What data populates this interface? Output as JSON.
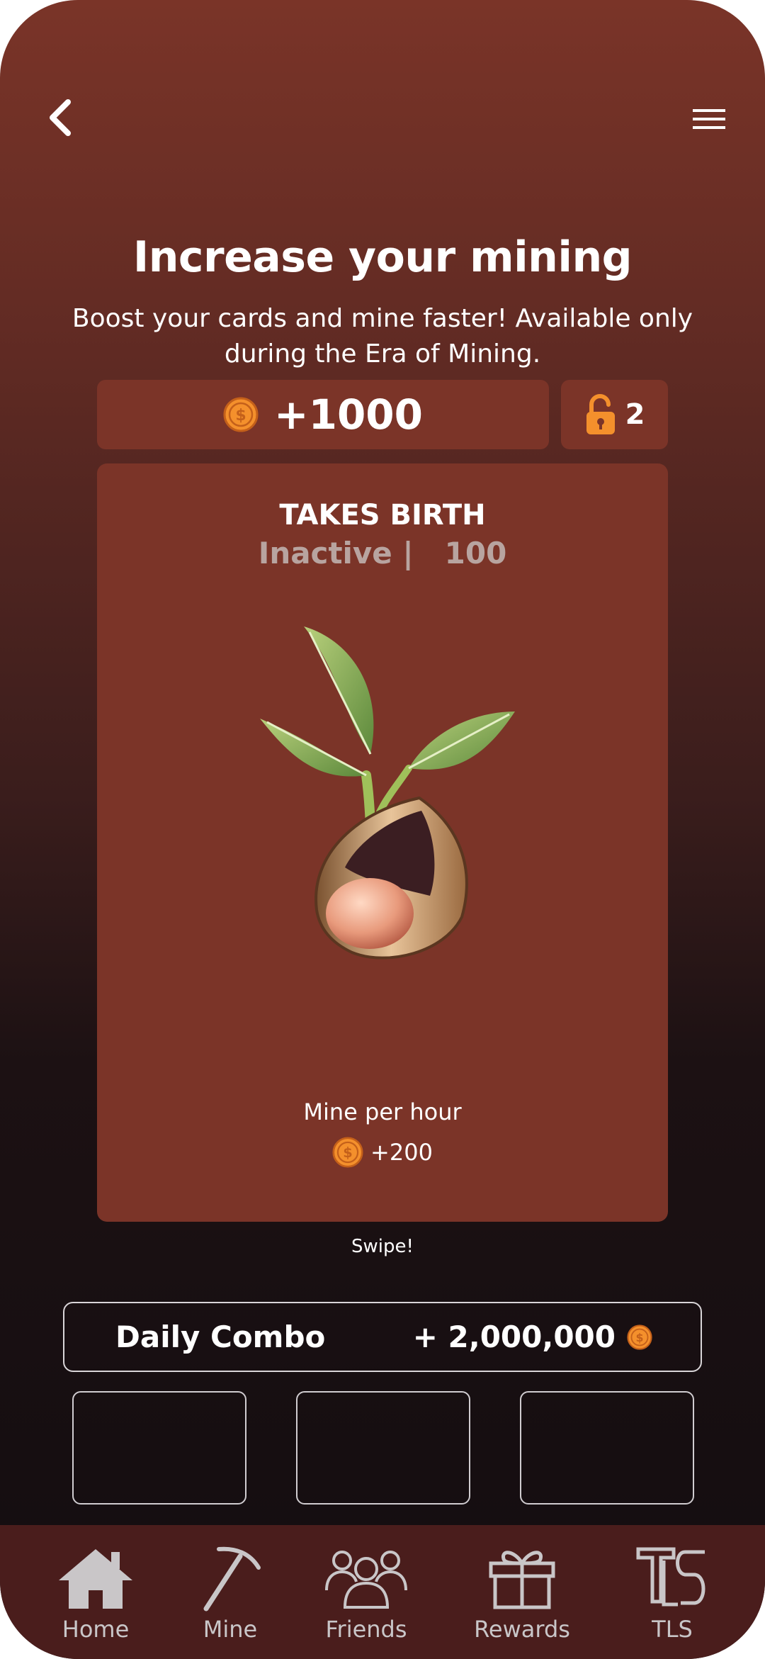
{
  "header": {
    "title": "Increase your mining",
    "subtitle": "Boost your cards and mine faster! Available only during the Era of Mining."
  },
  "balance": {
    "value": "+1000",
    "unlock_count": "2"
  },
  "card": {
    "title": "TAKES BIRTH",
    "status": "Inactive |   100",
    "image_icon": "sprout-seed",
    "mine_per_hour_label": "Mine per hour",
    "mine_per_hour_value": "+200"
  },
  "swipe_hint": "Swipe!",
  "daily_combo": {
    "label": "Daily Combo",
    "reward": "+ 2,000,000"
  },
  "nav": [
    {
      "label": "Home",
      "icon": "home-icon"
    },
    {
      "label": "Mine",
      "icon": "pickaxe-icon"
    },
    {
      "label": "Friends",
      "icon": "friends-icon"
    },
    {
      "label": "Rewards",
      "icon": "gift-icon"
    },
    {
      "label": "TLS",
      "icon": "tls-logo-icon"
    }
  ],
  "colors": {
    "card_bg": "#7b3428",
    "coin": "#f4902c",
    "nav_bg": "#4a1d1c"
  }
}
